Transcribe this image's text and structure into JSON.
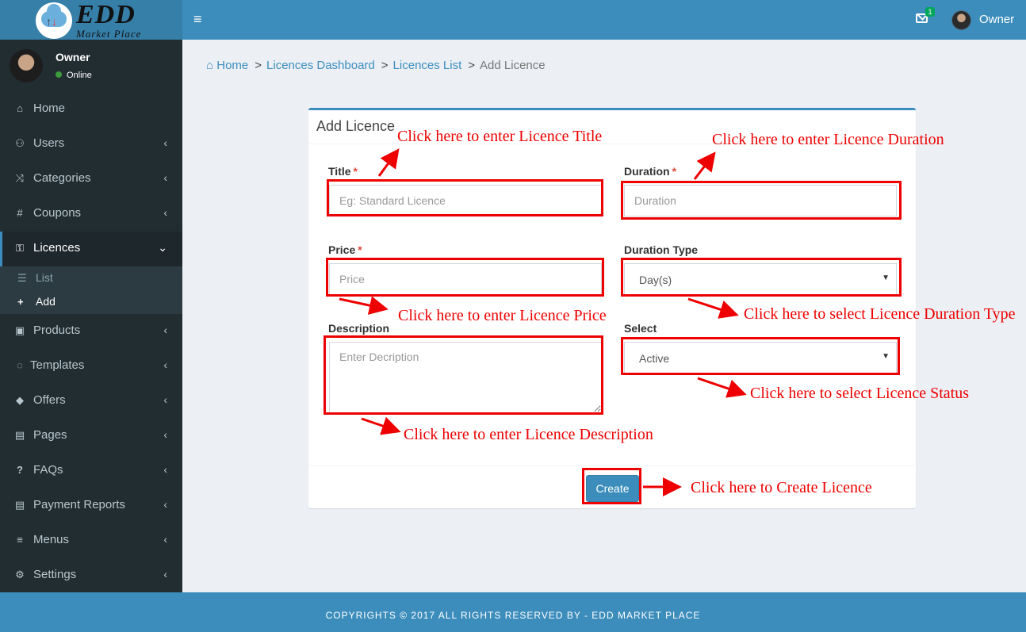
{
  "brand": {
    "title": "EDD",
    "subtitle": "Market Place"
  },
  "header": {
    "toggle_icon": "≡",
    "mail_count": "1",
    "user_name": "Owner"
  },
  "sidebar": {
    "user": {
      "name": "Owner",
      "status": "Online"
    },
    "items": [
      {
        "label": "Home",
        "icon": "⌂"
      },
      {
        "label": "Users",
        "icon": "⚇"
      },
      {
        "label": "Categories",
        "icon": "⤨"
      },
      {
        "label": "Coupons",
        "icon": "#"
      },
      {
        "label": "Licences",
        "icon": "⚿"
      },
      {
        "label": "Products",
        "icon": "▣"
      },
      {
        "label": "Templates",
        "icon": "◌"
      },
      {
        "label": "Offers",
        "icon": "◆"
      },
      {
        "label": "Pages",
        "icon": "▤"
      },
      {
        "label": "FAQs",
        "icon": "?"
      },
      {
        "label": "Payment Reports",
        "icon": "▤"
      },
      {
        "label": "Menus",
        "icon": "≡"
      },
      {
        "label": "Settings",
        "icon": "⚙"
      }
    ],
    "chevron_closed": "‹",
    "chevron_open": "⌄",
    "licences_sub": [
      {
        "label": "List",
        "icon": "☰"
      },
      {
        "label": "Add",
        "icon": "+"
      }
    ]
  },
  "breadcrumb": {
    "home": "Home",
    "home_icon": "⌂",
    "dashboard": "Licences Dashboard",
    "list": "Licences List",
    "current": "Add Licence",
    "sep": ">"
  },
  "form": {
    "title": "Add Licence",
    "required_mark": "*",
    "title_label": "Title",
    "title_placeholder": "Eg: Standard Licence",
    "duration_label": "Duration",
    "duration_placeholder": "Duration",
    "price_label": "Price",
    "price_placeholder": "Price",
    "duration_type_label": "Duration Type",
    "duration_type_value": "Day(s)",
    "description_label": "Description",
    "description_placeholder": "Enter Decription",
    "select_label": "Select",
    "select_value": "Active",
    "caret": "▼",
    "create_label": "Create"
  },
  "annotations": {
    "title": "Click here to enter Licence Title",
    "duration": "Click here to enter Licence Duration",
    "price": "Click here to enter Licence Price",
    "duration_type": "Click here to select Licence Duration Type",
    "status": "Click here to select Licence Status",
    "description": "Click here to enter Licence Description",
    "create": "Click here to Create Licence",
    "color": "#ee0000"
  },
  "footer": {
    "text": "COPYRIGHTS © 2017 ALL RIGHTS RESERVED BY - EDD MARKET PLACE"
  }
}
